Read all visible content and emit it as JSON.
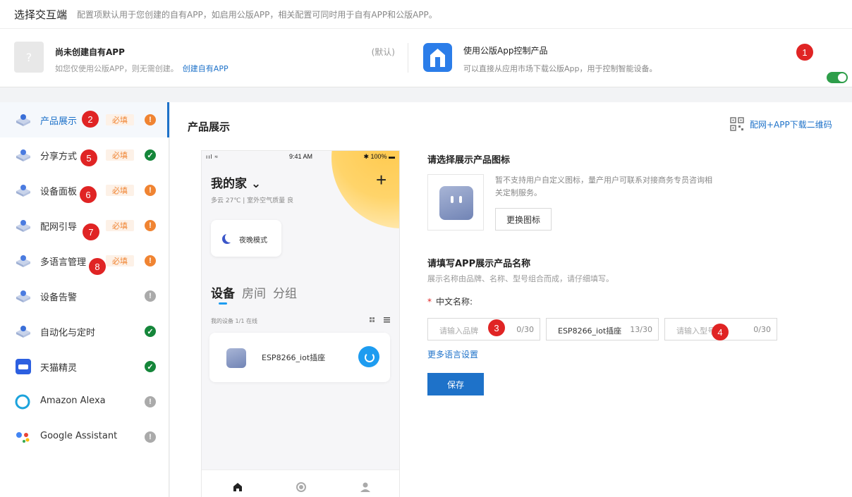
{
  "header": {
    "title": "选择交互端",
    "desc": "配置项默认用于您创建的自有APP，如启用公版APP，相关配置可同时用于自有APP和公版APP。"
  },
  "own_app": {
    "placeholder_glyph": "?",
    "name": "尚未创建自有APP",
    "sub": "如您仅使用公版APP，则无需创建。",
    "create_link": "创建自有APP",
    "default_label": "(默认)"
  },
  "public_app": {
    "icon": "house-icon",
    "name": "使用公版App控制产品",
    "sub": "可以直接从应用市场下载公版App，用于控制智能设备。",
    "toggle_on": true
  },
  "markers": [
    "1",
    "2",
    "3",
    "4",
    "5",
    "6",
    "7",
    "8"
  ],
  "sidebar": {
    "required_label": "必填",
    "items": [
      {
        "label": "产品展示",
        "icon": "product-display-icon",
        "required": true,
        "status": "warn",
        "status_glyph": "!",
        "active": true
      },
      {
        "label": "分享方式",
        "icon": "share-icon",
        "required": true,
        "status": "ok",
        "status_glyph": "✓"
      },
      {
        "label": "设备面板",
        "icon": "device-panel-icon",
        "required": true,
        "status": "warn",
        "status_glyph": "!"
      },
      {
        "label": "配网引导",
        "icon": "network-guide-icon",
        "required": true,
        "status": "warn",
        "status_glyph": "!"
      },
      {
        "label": "多语言管理",
        "icon": "multi-language-icon",
        "required": true,
        "status": "warn",
        "status_glyph": "!"
      },
      {
        "label": "设备告警",
        "icon": "device-alarm-icon",
        "required": false,
        "status": "gray",
        "status_glyph": "!"
      },
      {
        "label": "自动化与定时",
        "icon": "automation-timer-icon",
        "required": false,
        "status": "ok",
        "status_glyph": "✓"
      },
      {
        "label": "天猫精灵",
        "icon": "tmall-genie-icon",
        "required": false,
        "status": "ok",
        "status_glyph": "✓"
      },
      {
        "label": "Amazon Alexa",
        "icon": "alexa-icon",
        "required": false,
        "status": "gray",
        "status_glyph": "!"
      },
      {
        "label": "Google Assistant",
        "icon": "google-assistant-icon",
        "required": false,
        "status": "gray",
        "status_glyph": "!"
      }
    ]
  },
  "main": {
    "title": "产品展示",
    "qr_link": "配网+APP下载二维码"
  },
  "phone": {
    "signal": "ııl ≈",
    "time": "9:41 AM",
    "battery": "✱ 100% ▬",
    "home_title": "我的家 ⌄",
    "plus": "+",
    "weather": "多云 27℃  |  室外空气质量 良",
    "scene": "夜晚模式",
    "tabs": [
      "设备",
      "房间",
      "分组"
    ],
    "device_meta": "我的设备   1/1 在线",
    "device_name": "ESP8266_iot插座"
  },
  "form": {
    "icon_title": "请选择展示产品图标",
    "icon_note": "暂不支持用户自定义图标，量产用户可联系对接商务专员咨询相关定制服务。",
    "change_icon_btn": "更换图标",
    "name_title": "请填写APP展示产品名称",
    "name_desc": "展示名称由品牌、名称、型号组合而成，请仔细填写。",
    "required_star": "*",
    "cn_label": "中文名称:",
    "brand": {
      "placeholder": "请输入品牌",
      "value": "",
      "count": "0/30"
    },
    "name": {
      "placeholder": "",
      "value": "ESP8266_iot插座",
      "count": "13/30"
    },
    "model": {
      "placeholder": "请输入型号",
      "value": "",
      "count": "0/30"
    },
    "more_lang": "更多语言设置",
    "save_btn": "保存"
  },
  "colors": {
    "accent": "#1e72c9",
    "warn": "#f08432",
    "ok": "#15863a",
    "marker": "#e02424"
  }
}
